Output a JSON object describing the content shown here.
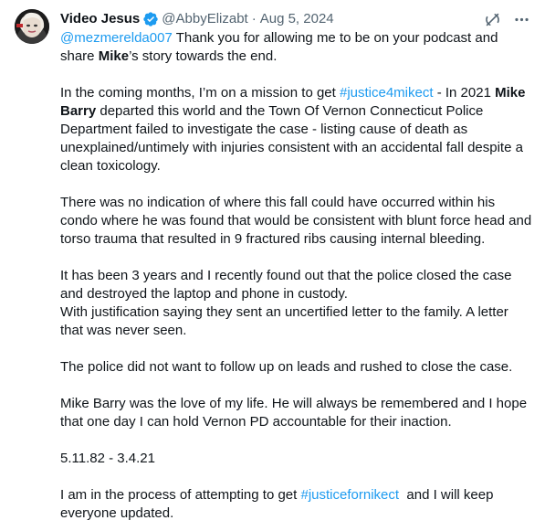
{
  "author": {
    "display_name": "Video Jesus",
    "handle": "@AbbyElizabt",
    "separator": "·",
    "date": "Aug 5, 2024",
    "verified_color": "#1d9bf0"
  },
  "icons": {
    "verified": "verified-badge-icon",
    "grok": "grok-icon",
    "more": "more-options-icon"
  },
  "colors": {
    "link": "#1d9bf0",
    "text": "#0f1419",
    "secondary": "#536471"
  },
  "tweet": {
    "p1": {
      "mention": "@mezmerelda007",
      "t1": " Thank you for allowing me to be on your podcast and share ",
      "bold1": "Mike",
      "t2": "’s story towards the end."
    },
    "p2": {
      "t1": "In the coming months, I’m on a mission to get ",
      "hashtag": "#justice4mikect",
      "t2": " - In 2021 ",
      "bold1": "Mike Barry",
      "t3": " departed this world and the Town Of Vernon Connecticut Police Department failed to investigate the case - listing cause of death as unexplained/untimely with injuries consistent with an accidental fall despite a clean toxicology."
    },
    "p3": "There was no indication of where this fall could have occurred within his condo where he was found that would be consistent with blunt force head and torso trauma that resulted in 9 fractured ribs causing internal bleeding.",
    "p4a": "It has been 3 years and I recently found out that the police closed the case and destroyed the laptop and phone in custody.",
    "p4b": "With justification saying they sent an uncertified letter to the family. A letter that was never seen.",
    "p5": "The police did not want to follow up on leads and rushed to close the case.",
    "p6": "Mike Barry was the love of my life. He will always be remembered and I hope that one day I can hold Vernon PD accountable for their inaction.",
    "p7": "5.11.82 - 3.4.21",
    "p8": {
      "t1": "I am in the process of attempting to get ",
      "hashtag": "#justicefornikect",
      "t2": "  and I will keep everyone updated."
    }
  }
}
